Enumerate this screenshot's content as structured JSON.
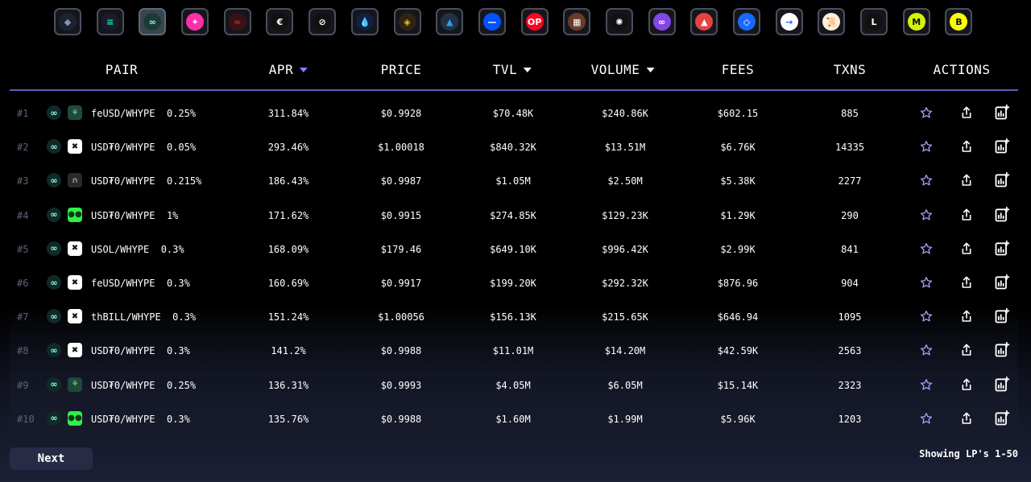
{
  "chains": [
    {
      "name": "ethereum-icon",
      "glyph": "◆",
      "color": "#8a92b2",
      "bg": "#1d2233"
    },
    {
      "name": "solana-icon",
      "glyph": "≡",
      "color": "#14f195",
      "bg": "#1b1b2e"
    },
    {
      "name": "hyperevm-icon",
      "glyph": "∞",
      "color": "#97fce4",
      "bg": "#1b3a38",
      "active": true
    },
    {
      "name": "star-chain-icon",
      "glyph": "✦",
      "color": "#ffffff",
      "bg": "#ff2fa8"
    },
    {
      "name": "sei-icon",
      "glyph": "≈",
      "color": "#c2272d",
      "bg": "#3a1214"
    },
    {
      "name": "ethena-icon",
      "glyph": "€",
      "color": "#ffffff",
      "bg": "#111111"
    },
    {
      "name": "stripe-chain-icon",
      "glyph": "⊘",
      "color": "#ffffff",
      "bg": "#111111"
    },
    {
      "name": "sui-icon",
      "glyph": "💧",
      "color": "#4da2ff",
      "bg": "#0d2340"
    },
    {
      "name": "bnb-icon",
      "glyph": "◈",
      "color": "#f3ba2f",
      "bg": "#2d2510"
    },
    {
      "name": "arbitrum-icon",
      "glyph": "▲",
      "color": "#28a0f0",
      "bg": "#213147"
    },
    {
      "name": "base-icon",
      "glyph": "—",
      "color": "#ffffff",
      "bg": "#0052ff"
    },
    {
      "name": "optimism-icon",
      "glyph": "OP",
      "color": "#ffffff",
      "bg": "#ff0420"
    },
    {
      "name": "monad-cat-icon",
      "glyph": "▦",
      "color": "#ffffff",
      "bg": "#6b3a2a"
    },
    {
      "name": "sunburst-icon",
      "glyph": "✺",
      "color": "#ffffff",
      "bg": "#111111"
    },
    {
      "name": "polygon-icon",
      "glyph": "∞",
      "color": "#ffffff",
      "bg": "#8247e5"
    },
    {
      "name": "avalanche-icon",
      "glyph": "▲",
      "color": "#ffffff",
      "bg": "#e84142"
    },
    {
      "name": "fantom-icon",
      "glyph": "◇",
      "color": "#ffffff",
      "bg": "#1969ff"
    },
    {
      "name": "arrow-chain-icon",
      "glyph": "→",
      "color": "#1c6cff",
      "bg": "#ffffff"
    },
    {
      "name": "scroll-icon",
      "glyph": "📜",
      "color": "#ffeeda",
      "bg": "#ffeeda"
    },
    {
      "name": "linea-icon",
      "glyph": "L",
      "color": "#ffffff",
      "bg": "#111111"
    },
    {
      "name": "mantle-icon",
      "glyph": "M",
      "color": "#111111",
      "bg": "#d5f20b"
    },
    {
      "name": "blast-icon",
      "glyph": "B",
      "color": "#111111",
      "bg": "#fcfc03"
    }
  ],
  "columns": {
    "pair": "PAIR",
    "apr": "APR",
    "price": "PRICE",
    "tvl": "TVL",
    "volume": "VOLUME",
    "fees": "FEES",
    "txns": "TXNS",
    "actions": "ACTIONS"
  },
  "rows": [
    {
      "rank": "#1",
      "pair": "feUSD/WHYPE",
      "fee": "0.25%",
      "dex": "dex-leaf-icon",
      "dexColor": "#1f4a3a",
      "dexGlyph": "⚘",
      "dexGlyphColor": "#7fd6a4",
      "apr": "311.84%",
      "price": "$0.9928",
      "tvl": "$70.48K",
      "volume": "$240.86K",
      "fees": "$602.15",
      "txns": "885"
    },
    {
      "rank": "#2",
      "pair": "USD₮0/WHYPE",
      "fee": "0.05%",
      "dex": "dex-cross-icon",
      "dexColor": "#ffffff",
      "dexGlyph": "✖",
      "dexGlyphColor": "#111111",
      "apr": "293.46%",
      "price": "$1.00018",
      "tvl": "$840.32K",
      "volume": "$13.51M",
      "fees": "$6.76K",
      "txns": "14335"
    },
    {
      "rank": "#3",
      "pair": "USD₮0/WHYPE",
      "fee": "0.215%",
      "dex": "dex-arch-icon",
      "dexColor": "#2a2a2a",
      "dexGlyph": "∩",
      "dexGlyphColor": "#9a9a9a",
      "apr": "186.43%",
      "price": "$0.9987",
      "tvl": "$1.05M",
      "volume": "$2.50M",
      "fees": "$5.38K",
      "txns": "2277"
    },
    {
      "rank": "#4",
      "pair": "USD₮0/WHYPE",
      "fee": "1%",
      "dex": "dex-green-icon",
      "dexColor": "#2cf24a",
      "dexGlyph": "●●",
      "dexGlyphColor": "#0a3a10",
      "apr": "171.62%",
      "price": "$0.9915",
      "tvl": "$274.85K",
      "volume": "$129.23K",
      "fees": "$1.29K",
      "txns": "290"
    },
    {
      "rank": "#5",
      "pair": "USOL/WHYPE",
      "fee": "0.3%",
      "dex": "dex-cross-icon",
      "dexColor": "#ffffff",
      "dexGlyph": "✖",
      "dexGlyphColor": "#111111",
      "apr": "168.09%",
      "price": "$179.46",
      "tvl": "$649.10K",
      "volume": "$996.42K",
      "fees": "$2.99K",
      "txns": "841"
    },
    {
      "rank": "#6",
      "pair": "feUSD/WHYPE",
      "fee": "0.3%",
      "dex": "dex-cross-icon",
      "dexColor": "#ffffff",
      "dexGlyph": "✖",
      "dexGlyphColor": "#111111",
      "apr": "160.69%",
      "price": "$0.9917",
      "tvl": "$199.20K",
      "volume": "$292.32K",
      "fees": "$876.96",
      "txns": "904"
    },
    {
      "rank": "#7",
      "pair": "thBILL/WHYPE",
      "fee": "0.3%",
      "dex": "dex-cross-icon",
      "dexColor": "#ffffff",
      "dexGlyph": "✖",
      "dexGlyphColor": "#111111",
      "apr": "151.24%",
      "price": "$1.00056",
      "tvl": "$156.13K",
      "volume": "$215.65K",
      "fees": "$646.94",
      "txns": "1095"
    },
    {
      "rank": "#8",
      "pair": "USD₮0/WHYPE",
      "fee": "0.3%",
      "dex": "dex-cross-icon",
      "dexColor": "#ffffff",
      "dexGlyph": "✖",
      "dexGlyphColor": "#111111",
      "apr": "141.2%",
      "price": "$0.9988",
      "tvl": "$11.01M",
      "volume": "$14.20M",
      "fees": "$42.59K",
      "txns": "2563"
    },
    {
      "rank": "#9",
      "pair": "USD₮0/WHYPE",
      "fee": "0.25%",
      "dex": "dex-leaf-icon",
      "dexColor": "#1f4a3a",
      "dexGlyph": "⚘",
      "dexGlyphColor": "#7fd6a4",
      "apr": "136.31%",
      "price": "$0.9993",
      "tvl": "$4.05M",
      "volume": "$6.05M",
      "fees": "$15.14K",
      "txns": "2323"
    },
    {
      "rank": "#10",
      "pair": "USD₮0/WHYPE",
      "fee": "0.3%",
      "dex": "dex-green-icon",
      "dexColor": "#2cf24a",
      "dexGlyph": "●●",
      "dexGlyphColor": "#0a3a10",
      "apr": "135.76%",
      "price": "$0.9988",
      "tvl": "$1.60M",
      "volume": "$1.99M",
      "fees": "$5.96K",
      "txns": "1203"
    }
  ],
  "footer": {
    "next_label": "Next",
    "showing": "Showing LP's 1-50"
  },
  "colors": {
    "accent": "#8c7df0",
    "divider": "#6558b8",
    "hype": "#97fce4"
  }
}
